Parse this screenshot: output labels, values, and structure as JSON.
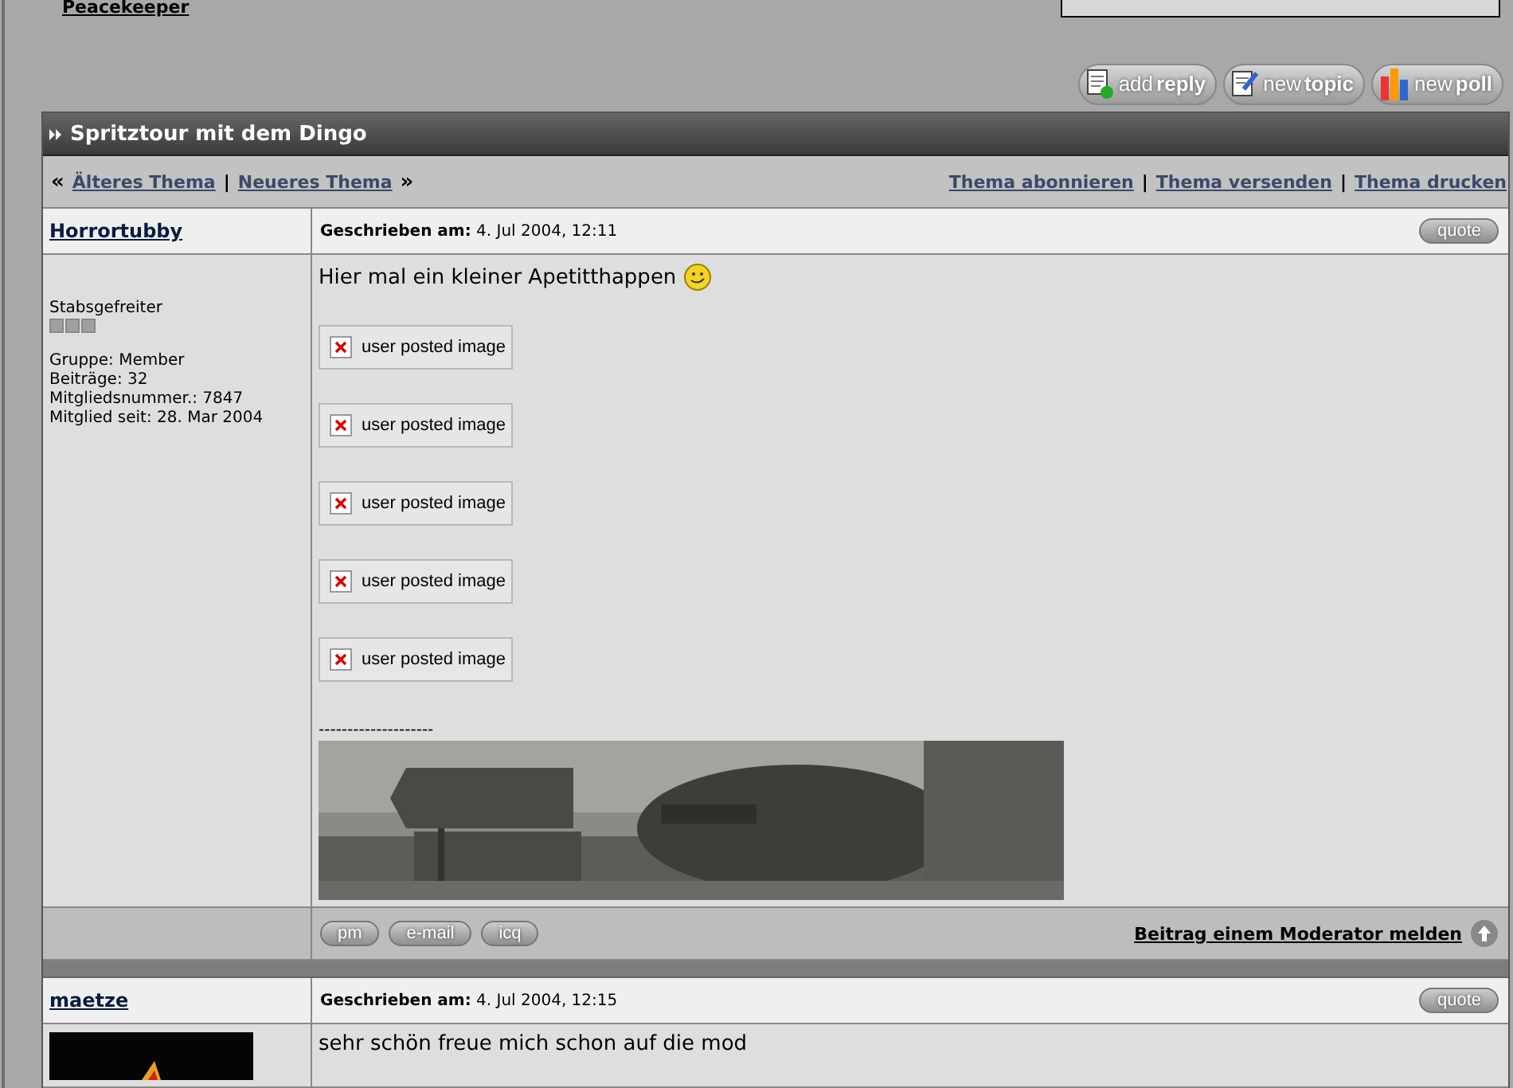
{
  "board_title": "Peacekeeper",
  "action_buttons": [
    {
      "kind": "reply",
      "label_light": "add",
      "label_bold": "reply"
    },
    {
      "kind": "topic",
      "label_light": "new",
      "label_bold": "topic"
    },
    {
      "kind": "poll",
      "label_light": "new",
      "label_bold": "poll"
    }
  ],
  "topic": {
    "title": "Spritztour mit dem Dingo"
  },
  "nav": {
    "prev_mark": "«",
    "prev": "Älteres Thema",
    "divider": "|",
    "next": "Neueres Thema",
    "next_mark": "»",
    "links": [
      "Thema abonnieren",
      "Thema versenden",
      "Thema drucken"
    ],
    "link_dividers": [
      "|",
      "|"
    ]
  },
  "posts": [
    {
      "author": "Horrortubby",
      "written_label": "Geschrieben am:",
      "date": "4. Jul 2004, 12:11",
      "quote": "quote",
      "rank": "Stabsgefreiter",
      "info": [
        "Gruppe: Member",
        "Beiträge: 32",
        "Mitgliedsnummer.: 7847",
        "Mitglied seit: 28. Mar 2004"
      ],
      "text": "Hier mal ein kleiner Apetitthappen",
      "smiley": true,
      "images": [
        "user posted image",
        "user posted image",
        "user posted image",
        "user posted image",
        "user posted image"
      ],
      "signature_rule": "--------------------",
      "banner": {
        "kind": "picture"
      },
      "footer_buttons": [
        "pm",
        "e-mail",
        "icq"
      ],
      "report": "Beitrag einem Moderator melden"
    },
    {
      "author": "maetze",
      "written_label": "Geschrieben am:",
      "date": "4. Jul 2004, 12:15",
      "quote": "quote",
      "avatar": {
        "kind": "picture"
      },
      "text": "sehr schön freue mich schon auf die mod",
      "smiley": false
    }
  ]
}
